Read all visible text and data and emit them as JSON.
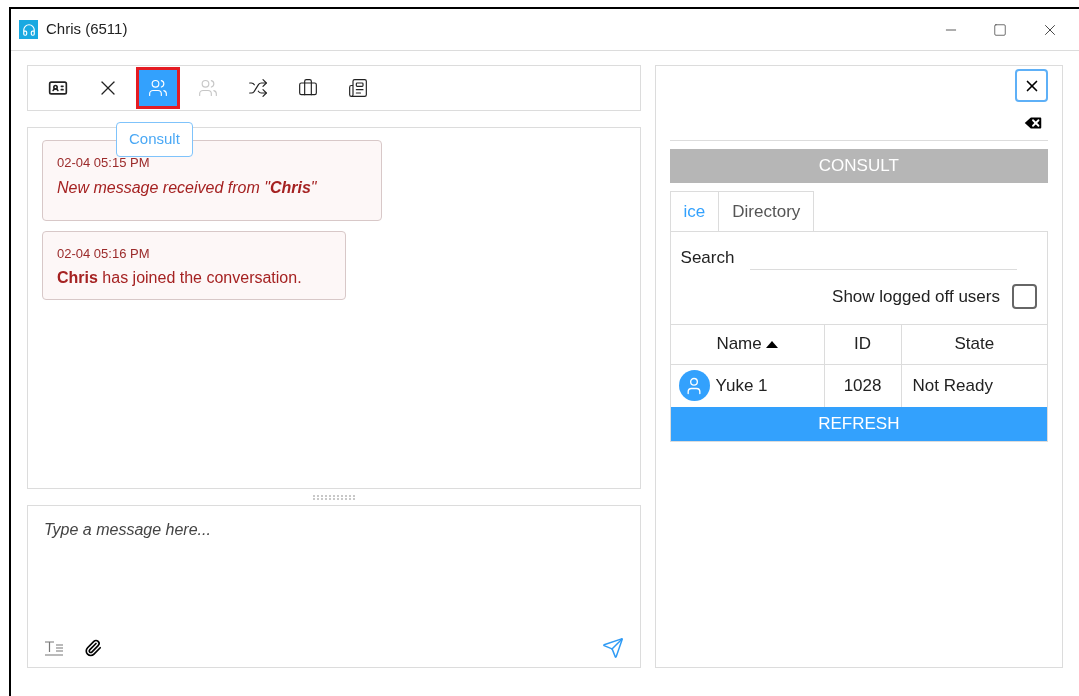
{
  "window": {
    "title": "Chris (6511)"
  },
  "toolbar": {
    "buttons": [
      {
        "kind": "contact",
        "selected": false,
        "disabled": false
      },
      {
        "kind": "end",
        "selected": false,
        "disabled": false
      },
      {
        "kind": "consult",
        "selected": true,
        "disabled": false
      },
      {
        "kind": "conference",
        "selected": false,
        "disabled": true
      },
      {
        "kind": "transfer",
        "selected": false,
        "disabled": false
      },
      {
        "kind": "briefcase",
        "selected": false,
        "disabled": false
      },
      {
        "kind": "document",
        "selected": false,
        "disabled": false
      }
    ],
    "tooltip": "Consult"
  },
  "messages": [
    {
      "kind": "notice",
      "time": "02-04 05:15 PM",
      "text": "New message received from \"**Chris**\""
    },
    {
      "kind": "event",
      "time": "02-04 05:16 PM",
      "text": "**Chris** has joined the conversation."
    }
  ],
  "composer": {
    "placeholder": "Type a message here..."
  },
  "consult_panel": {
    "header": "CONSULT",
    "tabs": [
      {
        "label": "ice",
        "selected": true
      },
      {
        "label": "Directory",
        "selected": false
      }
    ],
    "search_label": "Search",
    "show_logged_off": {
      "label": "Show logged off users",
      "checked": false
    },
    "columns": [
      {
        "label": "Name",
        "sorted": true
      },
      {
        "label": "ID",
        "sorted": false
      },
      {
        "label": "State",
        "sorted": false
      }
    ],
    "rows": [
      {
        "name": "Yuke 1",
        "id": "1028",
        "state": "Not Ready"
      }
    ],
    "refresh": "REFRESH"
  }
}
